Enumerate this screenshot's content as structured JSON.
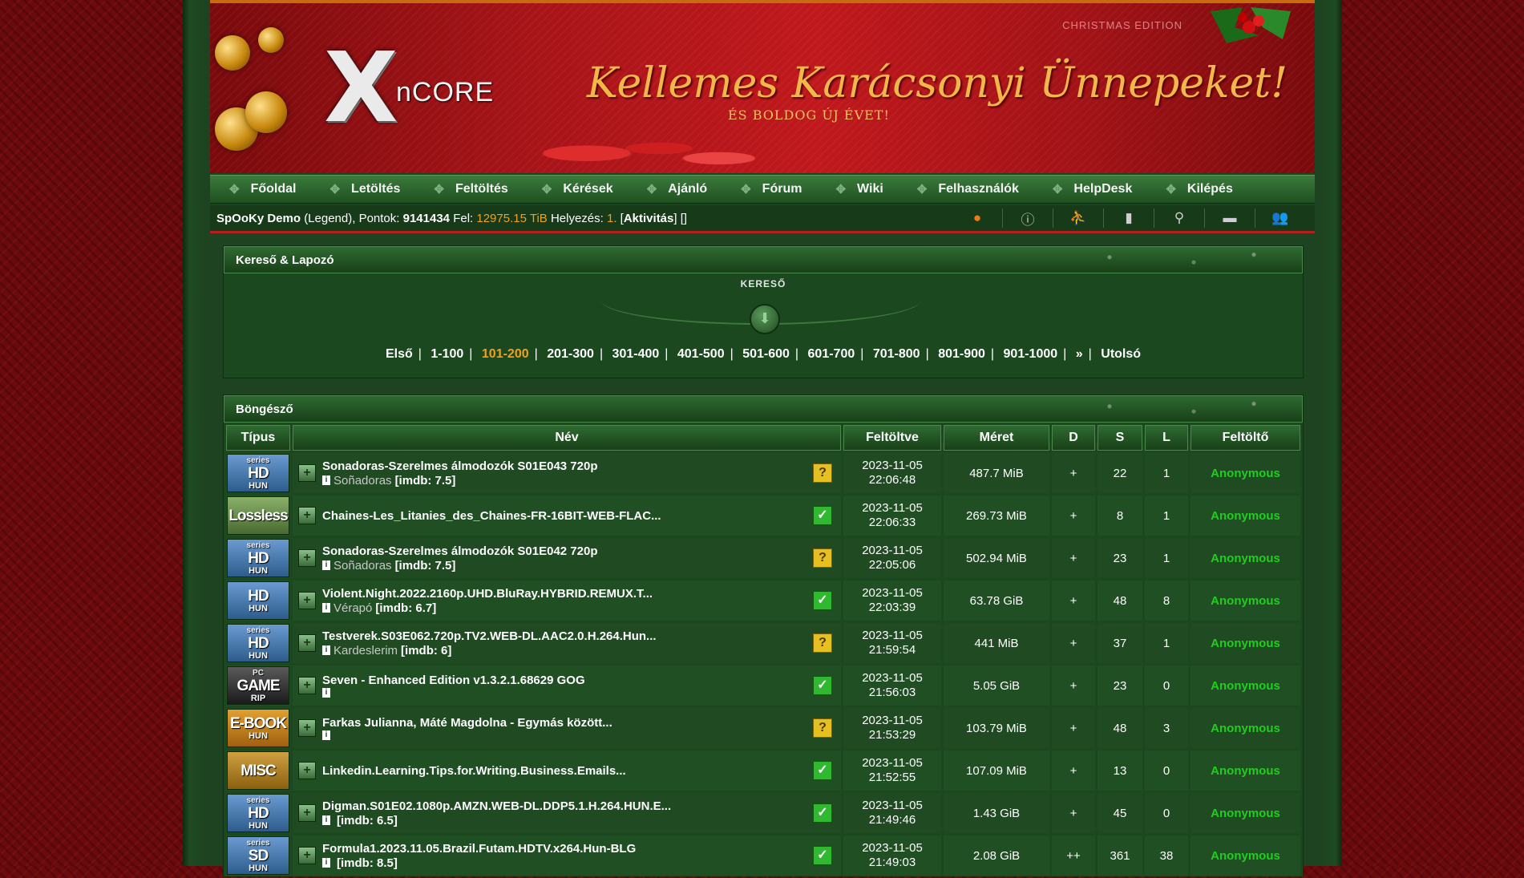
{
  "banner": {
    "edition": "CHRISTMAS EDITION",
    "logo_text": "nCORE",
    "greeting": "Kellemes Karácsonyi Ünnepeket!",
    "greeting_sub": "És Boldog Új Évet!"
  },
  "nav": {
    "items": [
      "Főoldal",
      "Letöltés",
      "Feltöltés",
      "Kérések",
      "Ajánló",
      "Fórum",
      "Wiki",
      "Felhasználók",
      "HelpDesk",
      "Kilépés"
    ]
  },
  "userbar": {
    "username": "SpOoKy Demo",
    "rank": "(Legend), Pontok:",
    "points": "9141434",
    "fel_label": "Fel:",
    "upload": "12975.15 TiB",
    "pos_label": "Helyezés:",
    "position": "1.",
    "activation": "Aktivitás",
    "brackets": "[]",
    "icons": [
      "pumpkin-icon",
      "alert-icon",
      "run-icon",
      "bookmark-icon",
      "search-icon",
      "ticket-icon",
      "users-icon"
    ]
  },
  "search_panel": {
    "title": "Kereső & Lapozó",
    "kereso_label": "KERESŐ",
    "pager": [
      "Első",
      "1-100",
      "101-200",
      "201-300",
      "301-400",
      "401-500",
      "501-600",
      "601-700",
      "701-800",
      "801-900",
      "901-1000",
      "»",
      "Utolsó"
    ],
    "pager_active": "101-200"
  },
  "browser": {
    "title": "Böngésző",
    "columns": [
      "Típus",
      "Név",
      "Feltöltve",
      "Méret",
      "D",
      "S",
      "L",
      "Feltöltő"
    ],
    "rows": [
      {
        "type": {
          "t1": "series",
          "t2": "HD",
          "t3": "HUN",
          "cls": "series"
        },
        "title": "Sonadoras-Szerelmes álmodozók S01E043 720p",
        "genre": "Soñadoras",
        "imdb": "[imdb: 7.5]",
        "check": "?",
        "date": "2023-11-05",
        "time": "22:06:48",
        "size": "487.7 MiB",
        "d": "+",
        "s": "22",
        "l": "1",
        "uploader": "Anonymous"
      },
      {
        "type": {
          "t1": "",
          "t2": "Lossless",
          "t3": "",
          "cls": "lossless"
        },
        "title": "Chaines-Les_Litanies_des_Chaines-FR-16BIT-WEB-FLAC...",
        "genre": "",
        "imdb": "",
        "check": "✓",
        "date": "2023-11-05",
        "time": "22:06:33",
        "size": "269.73 MiB",
        "d": "+",
        "s": "8",
        "l": "1",
        "uploader": "Anonymous"
      },
      {
        "type": {
          "t1": "series",
          "t2": "HD",
          "t3": "HUN",
          "cls": "series"
        },
        "title": "Sonadoras-Szerelmes álmodozók S01E042 720p",
        "genre": "Soñadoras",
        "imdb": "[imdb: 7.5]",
        "check": "?",
        "date": "2023-11-05",
        "time": "22:05:06",
        "size": "502.94 MiB",
        "d": "+",
        "s": "23",
        "l": "1",
        "uploader": "Anonymous"
      },
      {
        "type": {
          "t1": "",
          "t2": "HD",
          "t3": "HUN",
          "cls": "series"
        },
        "title": "Violent.Night.2022.2160p.UHD.BluRay.HYBRID.REMUX.T...",
        "genre": "Vérapó",
        "imdb": "[imdb: 6.7]",
        "check": "✓",
        "date": "2023-11-05",
        "time": "22:03:39",
        "size": "63.78 GiB",
        "d": "+",
        "s": "48",
        "l": "8",
        "uploader": "Anonymous"
      },
      {
        "type": {
          "t1": "series",
          "t2": "HD",
          "t3": "HUN",
          "cls": "series"
        },
        "title": "Testverek.S03E062.720p.TV2.WEB-DL.AAC2.0.H.264.Hun...",
        "genre": "Kardeslerim",
        "imdb": "[imdb: 6]",
        "check": "?",
        "date": "2023-11-05",
        "time": "21:59:54",
        "size": "441 MiB",
        "d": "+",
        "s": "37",
        "l": "1",
        "uploader": "Anonymous"
      },
      {
        "type": {
          "t1": "PC",
          "t2": "GAME",
          "t3": "RIP",
          "cls": "game"
        },
        "title": "Seven - Enhanced Edition v1.3.2.1.68629 GOG",
        "genre": "",
        "imdb": "",
        "check": "✓",
        "date": "2023-11-05",
        "time": "21:56:03",
        "size": "5.05 GiB",
        "d": "+",
        "s": "23",
        "l": "0",
        "uploader": "Anonymous"
      },
      {
        "type": {
          "t1": "",
          "t2": "E-BOOK",
          "t3": "HUN",
          "cls": "ebook"
        },
        "title": "Farkas Julianna, Máté Magdolna - Egymás között...",
        "genre": "",
        "imdb": "",
        "check": "?",
        "date": "2023-11-05",
        "time": "21:53:29",
        "size": "103.79 MiB",
        "d": "+",
        "s": "48",
        "l": "3",
        "uploader": "Anonymous"
      },
      {
        "type": {
          "t1": "",
          "t2": "MISC",
          "t3": "",
          "cls": "misc"
        },
        "title": "Linkedin.Learning.Tips.for.Writing.Business.Emails...",
        "genre": "",
        "imdb": "",
        "check": "✓",
        "date": "2023-11-05",
        "time": "21:52:55",
        "size": "107.09 MiB",
        "d": "+",
        "s": "13",
        "l": "0",
        "uploader": "Anonymous"
      },
      {
        "type": {
          "t1": "series",
          "t2": "HD",
          "t3": "HUN",
          "cls": "series"
        },
        "title": "Digman.S01E02.1080p.AMZN.WEB-DL.DDP5.1.H.264.HUN.E...",
        "genre": "",
        "imdb": "[imdb: 6.5]",
        "check": "✓",
        "date": "2023-11-05",
        "time": "21:49:46",
        "size": "1.43 GiB",
        "d": "+",
        "s": "45",
        "l": "0",
        "uploader": "Anonymous"
      },
      {
        "type": {
          "t1": "series",
          "t2": "SD",
          "t3": "HUN",
          "cls": "sd"
        },
        "title": "Formula1.2023.11.05.Brazil.Futam.HDTV.x264.Hun-BLG",
        "genre": "",
        "imdb": "[imdb: 8.5]",
        "check": "✓",
        "date": "2023-11-05",
        "time": "21:49:03",
        "size": "2.08 GiB",
        "d": "++",
        "s": "361",
        "l": "38",
        "uploader": "Anonymous"
      }
    ]
  }
}
